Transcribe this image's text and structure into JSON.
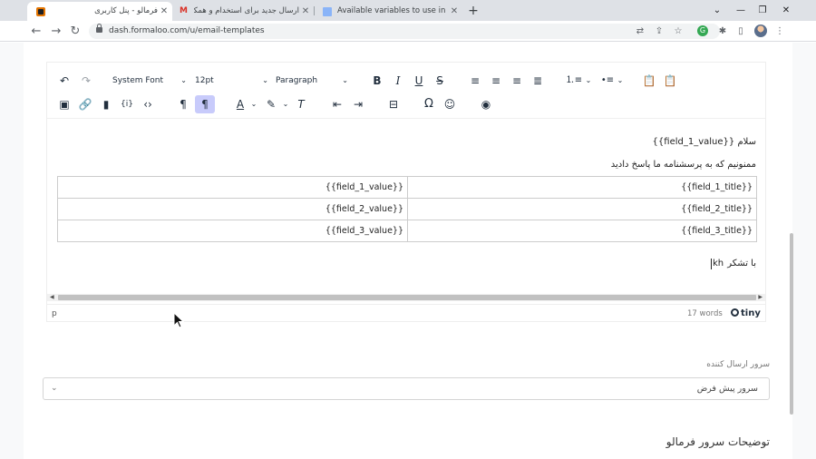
{
  "browser": {
    "tabs": [
      {
        "title": "فرمالو - پنل کاربری",
        "favicon": "formaloo-icon",
        "active": true
      },
      {
        "title": "ارسال جدید برای استخدام و همکاری",
        "favicon": "gmail-icon",
        "active": false
      },
      {
        "title": "Available variables to use in custo",
        "favicon": "doc-icon",
        "active": false
      }
    ],
    "new_tab": "+",
    "url": "dash.formaloo.com/u/email-templates"
  },
  "editor": {
    "toolbar": {
      "font_family": "System Font",
      "font_size": "12pt",
      "block_format": "Paragraph",
      "bold": "B",
      "italic": "I",
      "underline": "U",
      "strike": "S",
      "special_char": "Ω"
    },
    "content": {
      "greeting": "سلام {{field_1_value}}",
      "thanks": "ممنونیم که به پرسشنامه ما پاسخ دادید",
      "table": [
        {
          "title": "{{field_1_title}}",
          "value": "{{field_1_value}}"
        },
        {
          "title": "{{field_2_title}}",
          "value": "{{field_2_value}}"
        },
        {
          "title": "{{field_3_title}}",
          "value": "{{field_3_value}}"
        }
      ],
      "closing": "با تشکر",
      "closing_typed": "kh"
    },
    "status": {
      "path": "p",
      "word_count": "17 words",
      "brand": "tiny"
    }
  },
  "sender_server": {
    "label": "سرور ارسال کننده",
    "selected": "سرور پیش فرض"
  },
  "server_description_title": "توضیحات سرور فرمالو"
}
